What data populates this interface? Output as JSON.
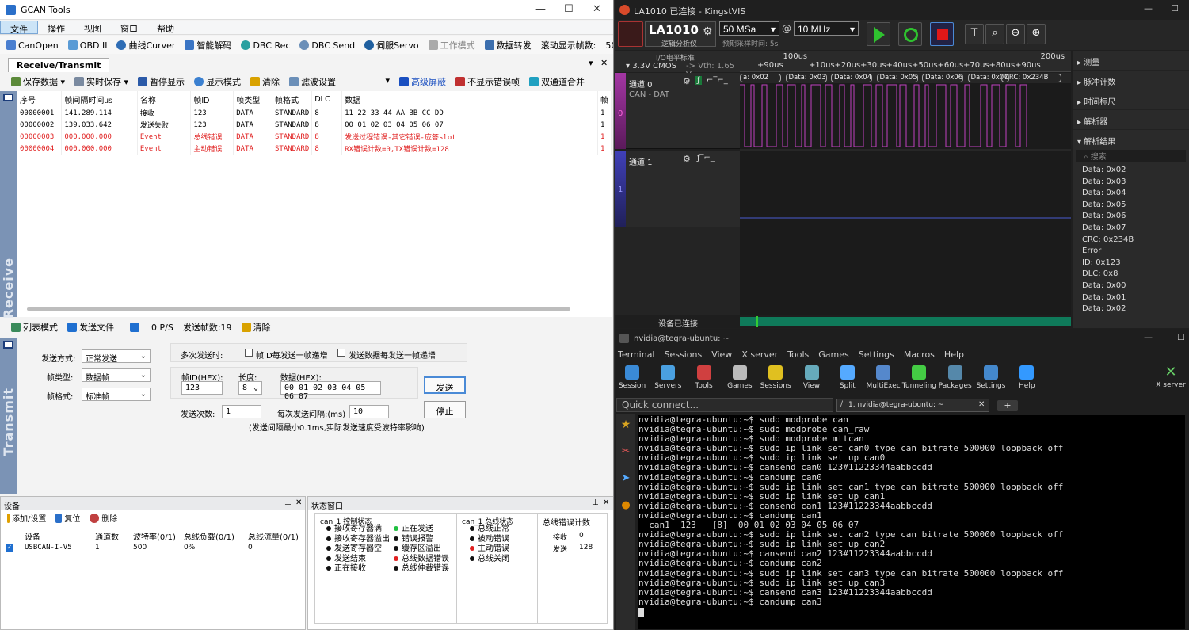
{
  "gcan": {
    "title": "GCAN Tools",
    "menu": [
      "文件",
      "操作",
      "视图",
      "窗口",
      "帮助"
    ],
    "toolbar": [
      "CanOpen",
      "OBD II",
      "曲线Curver",
      "智能解码",
      "DBC Rec",
      "DBC Send",
      "伺服Servo",
      "工作模式",
      "数据转发",
      "滚动显示帧数:",
      "5000"
    ],
    "tab": "Receive/Transmit",
    "rx_toolbar": [
      "保存数据",
      "实时保存",
      "暂停显示",
      "显示模式",
      "清除",
      "滤波设置",
      "高级屏蔽",
      "不显示错误帧",
      "双通道合并"
    ],
    "columns": [
      "序号",
      "帧间隔时间us",
      "名称",
      "帧ID",
      "帧类型",
      "帧格式",
      "DLC",
      "数据",
      "帧"
    ],
    "rows": [
      [
        "00000001",
        "141.289.114",
        "接收",
        "123",
        "DATA",
        "STANDARD",
        "8",
        "11 22 33 44 AA BB CC DD",
        "1"
      ],
      [
        "00000002",
        "139.033.642",
        "发送失败",
        "123",
        "DATA",
        "STANDARD",
        "8",
        "00 01 02 03 04 05 06 07",
        "1"
      ],
      [
        "00000003",
        "000.000.000",
        "Event",
        "总线错误",
        "DATA",
        "STANDARD",
        "8",
        "发送过程错误-其它错误-应答slot",
        "1"
      ],
      [
        "00000004",
        "000.000.000",
        "Event",
        "主动错误",
        "DATA",
        "STANDARD",
        "8",
        "RX错误计数=0,TX错误计数=128",
        "1"
      ]
    ],
    "receive_label": "Receive",
    "tx_toolbar": [
      "列表模式",
      "发送文件",
      "0 P/S",
      "发送帧数:19",
      "清除"
    ],
    "transmit_label": "Transmit",
    "tx": {
      "send_mode_label": "发送方式:",
      "send_mode": "正常发送",
      "frame_type_label": "帧类型:",
      "frame_type": "数据帧",
      "frame_format_label": "帧格式:",
      "frame_format": "标准帧",
      "multi_label": "多次发送时:",
      "opt1": "帧ID每发送一帧递增",
      "opt2": "发送数据每发送一帧递增",
      "id_label": "帧ID(HEX):",
      "id": "123",
      "len_label": "长度:",
      "len": "8",
      "data_label": "数据(HEX):",
      "data": "00 01 02 03 04 05 06 07",
      "count_label": "发送次数:",
      "count": "1",
      "interval_label": "每次发送间隔:(ms)",
      "interval": "10",
      "note": "(发送间隔最小0.1ms,实际发送速度受波特率影响)",
      "send_btn": "发送",
      "stop_btn": "停止"
    },
    "device": {
      "title": "设备",
      "add": "添加/设置",
      "reset": "复位",
      "delete": "删除",
      "cols": [
        "设备",
        "通道数",
        "波特率(0/1)",
        "总线负载(0/1)",
        "总线流量(0/1)"
      ],
      "row": [
        "USBCAN-I-V5",
        "1",
        "500",
        "0%",
        "0"
      ]
    },
    "status": {
      "title": "状态窗口",
      "ctrl_title": "can_1 控制状态",
      "ctrl_left": [
        "接收寄存器满",
        "接收寄存器溢出",
        "发送寄存器空",
        "发送结束",
        "正在接收"
      ],
      "ctrl_right": [
        "正在发送",
        "错误报警",
        "缓存区溢出",
        "总线数据错误",
        "总线仲裁错误"
      ],
      "bus_title": "can_1 总线状态",
      "bus": [
        "总线正常",
        "被动错误",
        "主动错误",
        "总线关闭"
      ],
      "err_title": "总线错误计数",
      "rx_label": "接收",
      "rx_val": "0",
      "tx_label": "发送",
      "tx_val": "128"
    }
  },
  "kv": {
    "title": "LA1010 已连接 - KingstVIS",
    "device": "LA1010",
    "device_sub": "逻辑分析仪",
    "rate": "50 MSa",
    "freq": "10 MHz",
    "at": "@",
    "sample_time": "预期采样时间: 5s",
    "io_label": "I/O电平标准",
    "io_std": "3.3V CMOS",
    "vth": "-> Vth: 1.65 V",
    "time_labels": [
      "+90us",
      "100us",
      "+10us",
      "+20us",
      "+30us",
      "+40us",
      "+50us",
      "+60us",
      "+70us",
      "+80us",
      "+90us",
      "200us"
    ],
    "decode_labels": [
      "a: 0x02",
      "Data: 0x03",
      "Data: 0x04",
      "Data: 0x05",
      "Data: 0x06",
      "Data: 0x07",
      "CRC: 0x234B"
    ],
    "ch0": "通道 0",
    "ch0_sub": "CAN - DAT",
    "ch0_num": "0",
    "ch1": "通道 1",
    "ch1_num": "1",
    "status": "设备已连接",
    "panels": [
      "测量",
      "脉冲计数",
      "时间标尺",
      "解析器",
      "解析结果"
    ],
    "search": "搜索",
    "results": [
      "Data: 0x02",
      "Data: 0x03",
      "Data: 0x04",
      "Data: 0x05",
      "Data: 0x06",
      "Data: 0x07",
      "CRC: 0x234B",
      "Error",
      "ID: 0x123",
      "DLC: 0x8",
      "Data: 0x00",
      "Data: 0x01",
      "Data: 0x02"
    ]
  },
  "mx": {
    "title": "nvidia@tegra-ubuntu: ~",
    "menu": [
      "Terminal",
      "Sessions",
      "View",
      "X server",
      "Tools",
      "Games",
      "Settings",
      "Macros",
      "Help"
    ],
    "tools": [
      "Session",
      "Servers",
      "Tools",
      "Games",
      "Sessions",
      "View",
      "Split",
      "MultiExec",
      "Tunneling",
      "Packages",
      "Settings",
      "Help"
    ],
    "xserver": "X server",
    "quick": "Quick connect...",
    "tab": "1. nvidia@tegra-ubuntu: ~",
    "lines": [
      "nvidia@tegra-ubuntu:~$ sudo modprobe can",
      "nvidia@tegra-ubuntu:~$ sudo modprobe can_raw",
      "nvidia@tegra-ubuntu:~$ sudo modprobe mttcan",
      "nvidia@tegra-ubuntu:~$ sudo ip link set can0 type can bitrate 500000 loopback off",
      "nvidia@tegra-ubuntu:~$ sudo ip link set up can0",
      "nvidia@tegra-ubuntu:~$ cansend can0 123#11223344aabbccdd",
      "nvidia@tegra-ubuntu:~$ candump can0",
      "nvidia@tegra-ubuntu:~$ sudo ip link set can1 type can bitrate 500000 loopback off",
      "nvidia@tegra-ubuntu:~$ sudo ip link set up can1",
      "nvidia@tegra-ubuntu:~$ cansend can1 123#11223344aabbccdd",
      "nvidia@tegra-ubuntu:~$ candump can1",
      "  can1  123   [8]  00 01 02 03 04 05 06 07",
      "nvidia@tegra-ubuntu:~$ sudo ip link set can2 type can bitrate 500000 loopback off",
      "nvidia@tegra-ubuntu:~$ sudo ip link set up can2",
      "nvidia@tegra-ubuntu:~$ cansend can2 123#11223344aabbccdd",
      "nvidia@tegra-ubuntu:~$ candump can2",
      "nvidia@tegra-ubuntu:~$ sudo ip link set can3 type can bitrate 500000 loopback off",
      "nvidia@tegra-ubuntu:~$ sudo ip link set up can3",
      "nvidia@tegra-ubuntu:~$ cansend can3 123#11223344aabbccdd",
      "nvidia@tegra-ubuntu:~$ candump can3"
    ]
  }
}
